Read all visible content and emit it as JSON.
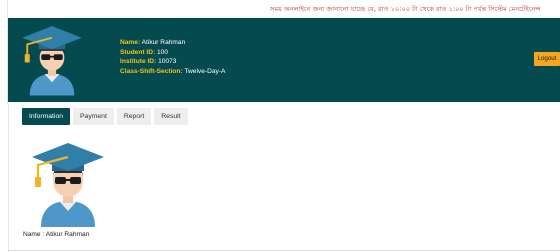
{
  "notice": "সময় অনলাইনে জন্য জানানো যাচ্ছে যে, রাত ১০:০০ টা থেকে রাত ১:০০ টা পর্যন্ত সিস্টেম মেনটেইনেন্স",
  "student": {
    "name_label": "Name:",
    "name": "Atikur Rahman",
    "student_id_label": "Student ID:",
    "student_id": "100",
    "institute_id_label": "Institute ID:",
    "institute_id": "10073",
    "class_label": "Class-Shift-Section:",
    "class": "Twelve-Day-A"
  },
  "logout_label": "Logout",
  "tabs": [
    {
      "label": "Information",
      "active": true
    },
    {
      "label": "Payment",
      "active": false
    },
    {
      "label": "Report",
      "active": false
    },
    {
      "label": "Result",
      "active": false
    }
  ],
  "profile": {
    "name_line": "Name : Atikur Rahman"
  },
  "icons": {
    "header_avatar": "student-graduate-icon",
    "profile_avatar": "student-graduate-icon"
  },
  "colors": {
    "header_bg": "#054a4f",
    "label_yellow": "#f0c419",
    "logout_bg": "#f5a623",
    "notice_text": "#c0392b",
    "active_tab": "#054a4f",
    "cap_blue": "#2f7fa8",
    "shirt_blue": "#4e97c9",
    "tassel": "#f0b429"
  }
}
